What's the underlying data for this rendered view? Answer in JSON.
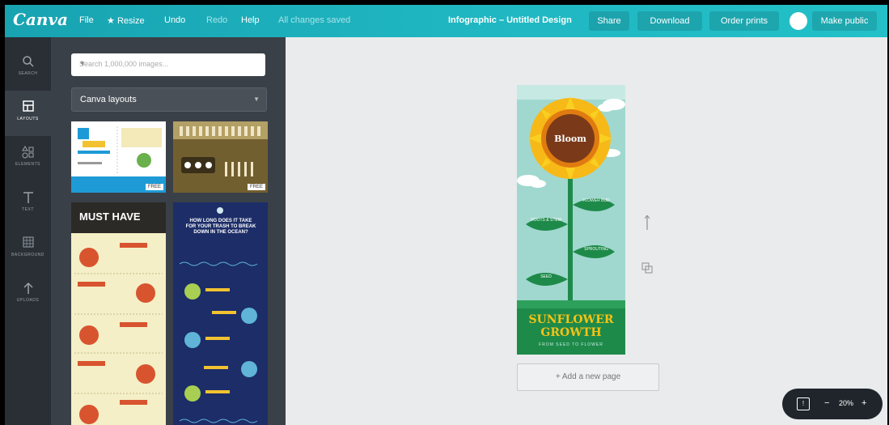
{
  "app": {
    "logo": "Canva",
    "menu": [
      "File",
      "Resize",
      "Undo",
      "Redo",
      "Help"
    ],
    "resize_star": "★",
    "status": "All changes saved",
    "design_title": "Infographic – Untitled Design",
    "buttons": {
      "share": "Share",
      "download": "Download",
      "order_prints": "Order prints",
      "make_public": "Make public"
    },
    "accent": "#1fb6c1"
  },
  "leftnav": [
    {
      "label": "SEARCH",
      "icon": "search-icon"
    },
    {
      "label": "LAYOUTS",
      "icon": "layouts-icon"
    },
    {
      "label": "ELEMENTS",
      "icon": "elements-icon"
    },
    {
      "label": "TEXT",
      "icon": "text-icon"
    },
    {
      "label": "BACKGROUND",
      "icon": "background-icon"
    },
    {
      "label": "UPLOADS",
      "icon": "upload-icon"
    }
  ],
  "panel": {
    "search_placeholder": "Search 1,000,000 images...",
    "layout_select": "Canva layouts",
    "free_badge": "FREE",
    "thumb3": {
      "title": "MUST HAVE",
      "items": [
        "TWITTER",
        "FACEBOOK",
        "INSTAGRAM",
        "TUMBLR",
        "PINTEREST"
      ]
    },
    "thumb4": {
      "title": "HOW LONG DOES IT TAKE FOR YOUR TRASH TO BREAK DOWN IN THE OCEAN?",
      "items": [
        "FRUIT PEEL",
        "CIGARETTE BUTT",
        "PLASTIC BAG",
        "SODA CAN",
        "PLASTIC BOTTLE"
      ]
    }
  },
  "design": {
    "bloom": "Bloom",
    "leaves": [
      "FLOWER BUD",
      "ROOTS & STEM",
      "SPROUTING",
      "SEED"
    ],
    "title_line1": "SUNFLOWER",
    "title_line2": "GROWTH",
    "subtitle": "FROM SEED TO FLOWER"
  },
  "canvas": {
    "add_page": "+ Add a new page",
    "zoom": "20%",
    "zoom_minus": "−",
    "zoom_plus": "+"
  }
}
